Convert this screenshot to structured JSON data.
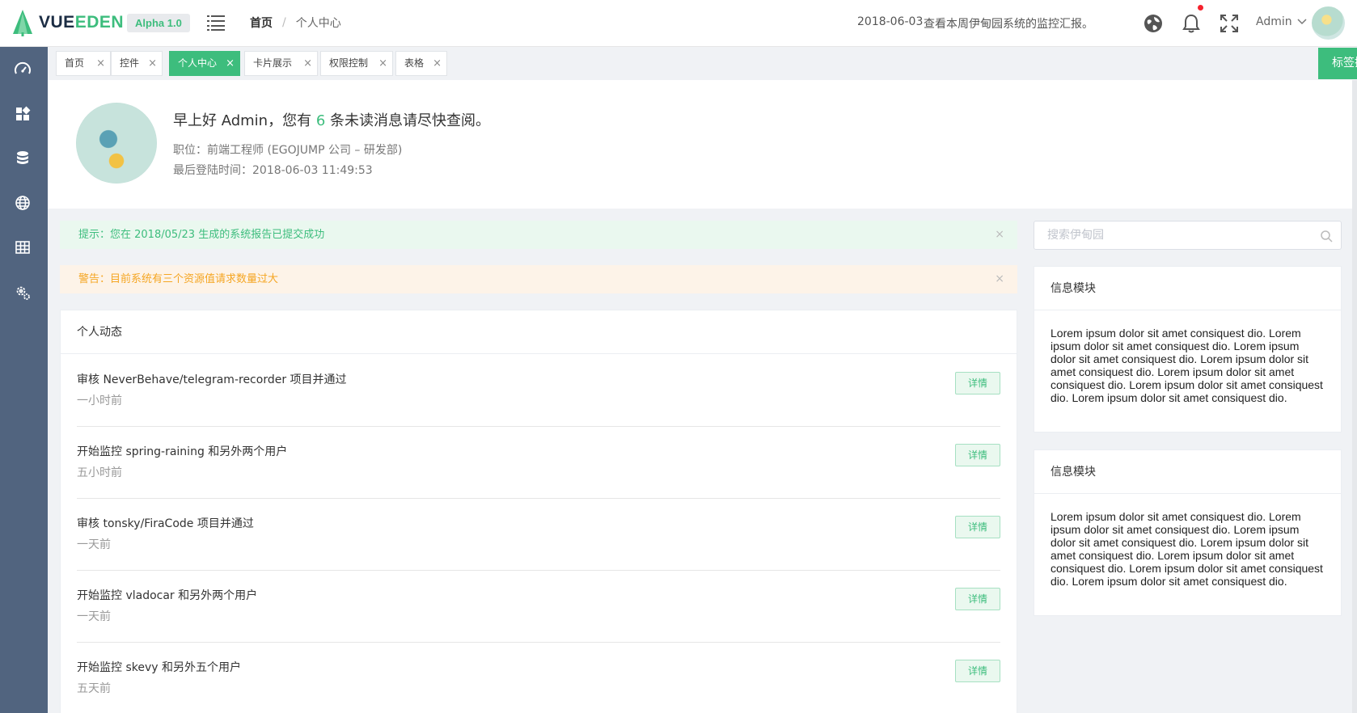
{
  "app": {
    "logo_prefix": "VUE",
    "logo_suffix": "EDEN",
    "version_badge": "Alpha 1.0"
  },
  "breadcrumb": {
    "home": "首页",
    "separator": "/",
    "current": "个人中心"
  },
  "header": {
    "date": "2018-06-03",
    "message": "查看本周伊甸园系统的监控汇报。",
    "user": "Admin",
    "icons": [
      "globe-icon",
      "bell-icon",
      "fullscreen-icon",
      "chevron-down-icon"
    ],
    "has_unread_dot": true
  },
  "sidebar": {
    "icons": [
      "dashboard-icon",
      "widgets-icon",
      "database-icon",
      "globe-icon",
      "table-icon",
      "settings-icon"
    ]
  },
  "tabs": [
    {
      "label": "首页",
      "active": false
    },
    {
      "label": "控件",
      "active": false
    },
    {
      "label": "个人中心",
      "active": true
    },
    {
      "label": "卡片展示",
      "active": false
    },
    {
      "label": "权限控制",
      "active": false
    },
    {
      "label": "表格",
      "active": false
    }
  ],
  "tab_close": "×",
  "tab_ops": {
    "label": "标签操作"
  },
  "profile": {
    "greeting_pre": "早上好 Admin，您有 ",
    "unread_count": "6",
    "greeting_post": " 条未读消息请尽快查阅。",
    "position": "职位：前端工程师 (EGOJUMP 公司 – 研发部)",
    "last_login": "最后登陆时间：2018-06-03 11:49:53"
  },
  "alerts": {
    "success": "提示：您在 2018/05/23 生成的系统报告已提交成功",
    "warning": "警告：目前系统有三个资源值请求数量过大",
    "close": "×"
  },
  "activity": {
    "title": "个人动态",
    "detail_label": "详情",
    "items": [
      {
        "text": "审核 NeverBehave/telegram-recorder 项目并通过",
        "time": "一小时前"
      },
      {
        "text": "开始监控 spring-raining 和另外两个用户",
        "time": "五小时前"
      },
      {
        "text": "审核 tonsky/FiraCode 项目并通过",
        "time": "一天前"
      },
      {
        "text": "开始监控 vladocar 和另外两个用户",
        "time": "一天前"
      },
      {
        "text": "开始监控 skevy 和另外五个用户",
        "time": "五天前"
      }
    ]
  },
  "search": {
    "placeholder": "搜索伊甸园",
    "value": ""
  },
  "info_blocks": [
    {
      "title": "信息模块",
      "body": "Lorem ipsum dolor sit amet consiquest dio. Lorem ipsum dolor sit amet consiquest dio. Lorem ipsum dolor sit amet consiquest dio. Lorem ipsum dolor sit amet consiquest dio. Lorem ipsum dolor sit amet consiquest dio. Lorem ipsum dolor sit amet consiquest dio. Lorem ipsum dolor sit amet consiquest dio."
    },
    {
      "title": "信息模块",
      "body": "Lorem ipsum dolor sit amet consiquest dio. Lorem ipsum dolor sit amet consiquest dio. Lorem ipsum dolor sit amet consiquest dio. Lorem ipsum dolor sit amet consiquest dio. Lorem ipsum dolor sit amet consiquest dio. Lorem ipsum dolor sit amet consiquest dio. Lorem ipsum dolor sit amet consiquest dio."
    }
  ],
  "colors": {
    "brand": "#3dbd7d",
    "sidebar": "#51647f",
    "success_bg": "#eaf8ef",
    "warning_text": "#f5a623",
    "unread_dot": "#f5222d"
  }
}
